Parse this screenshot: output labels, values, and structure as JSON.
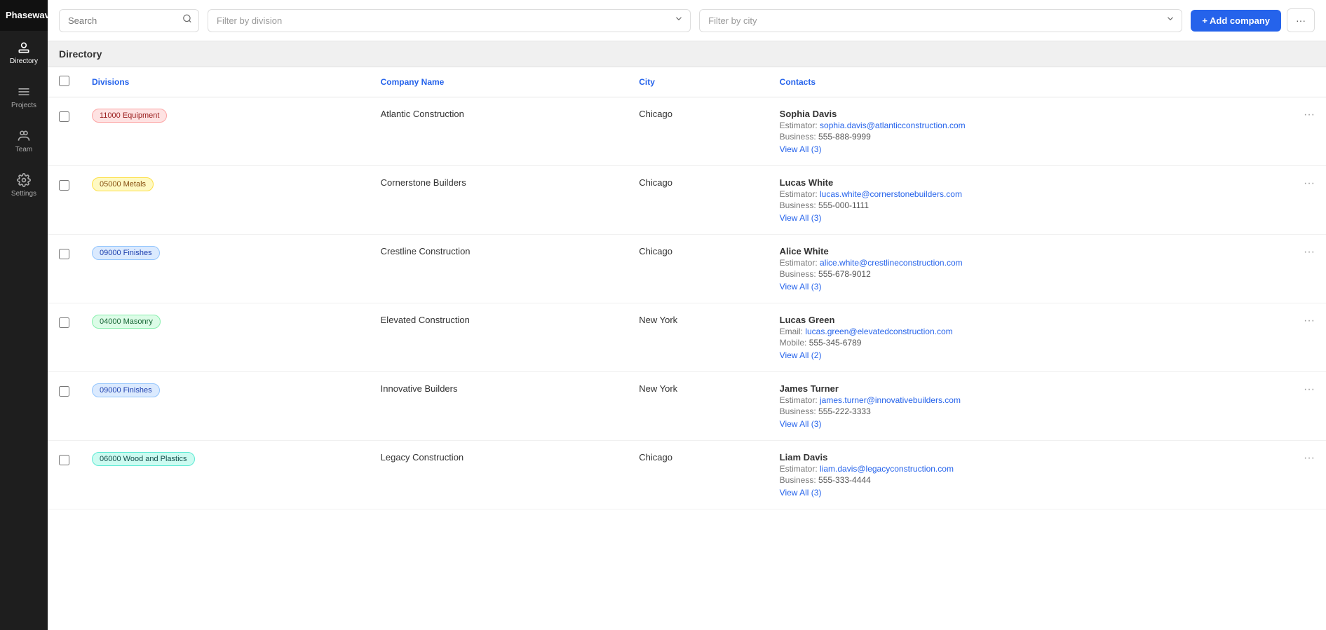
{
  "app": {
    "name": "Phasewave"
  },
  "sidebar": {
    "items": [
      {
        "id": "directory",
        "label": "Directory",
        "active": true
      },
      {
        "id": "projects",
        "label": "Projects",
        "active": false
      },
      {
        "id": "team",
        "label": "Team",
        "active": false
      },
      {
        "id": "settings",
        "label": "Settings",
        "active": false
      }
    ]
  },
  "topbar": {
    "search_placeholder": "Search",
    "filter_division_placeholder": "Filter by division",
    "filter_city_placeholder": "Filter by city",
    "add_company_label": "+ Add company",
    "more_label": "···"
  },
  "page_title": "Directory",
  "table": {
    "columns": [
      "Divisions",
      "Company Name",
      "City",
      "Contacts"
    ],
    "rows": [
      {
        "division": "11000 Equipment",
        "division_color": "red",
        "company": "Atlantic Construction",
        "city": "Chicago",
        "contact_name": "Sophia Davis",
        "contact_role": "Estimator",
        "contact_email": "sophia.davis@atlanticconstruction.com",
        "contact_phone_label": "Business",
        "contact_phone": "555-888-9999",
        "view_all_label": "View All (3)"
      },
      {
        "division": "05000 Metals",
        "division_color": "yellow",
        "company": "Cornerstone Builders",
        "city": "Chicago",
        "contact_name": "Lucas White",
        "contact_role": "Estimator",
        "contact_email": "lucas.white@cornerstonebuilders.com",
        "contact_phone_label": "Business",
        "contact_phone": "555-000-1111",
        "view_all_label": "View All (3)"
      },
      {
        "division": "09000 Finishes",
        "division_color": "blue",
        "company": "Crestline Construction",
        "city": "Chicago",
        "contact_name": "Alice White",
        "contact_role": "Estimator",
        "contact_email": "alice.white@crestlineconstruction.com",
        "contact_phone_label": "Business",
        "contact_phone": "555-678-9012",
        "view_all_label": "View All (3)"
      },
      {
        "division": "04000 Masonry",
        "division_color": "green",
        "company": "Elevated Construction",
        "city": "New York",
        "contact_name": "Lucas Green",
        "contact_role": "Email",
        "contact_email": "lucas.green@elevatedconstruction.com",
        "contact_phone_label": "Mobile",
        "contact_phone": "555-345-6789",
        "view_all_label": "View All (2)"
      },
      {
        "division": "09000 Finishes",
        "division_color": "blue",
        "company": "Innovative Builders",
        "city": "New York",
        "contact_name": "James Turner",
        "contact_role": "Estimator",
        "contact_email": "james.turner@innovativebuilders.com",
        "contact_phone_label": "Business",
        "contact_phone": "555-222-3333",
        "view_all_label": "View All (3)"
      },
      {
        "division": "06000 Wood and Plastics",
        "division_color": "teal",
        "company": "Legacy Construction",
        "city": "Chicago",
        "contact_name": "Liam Davis",
        "contact_role": "Estimator",
        "contact_email": "liam.davis@legacyconstruction.com",
        "contact_phone_label": "Business",
        "contact_phone": "555-333-4444",
        "view_all_label": "View All (3)"
      }
    ]
  }
}
